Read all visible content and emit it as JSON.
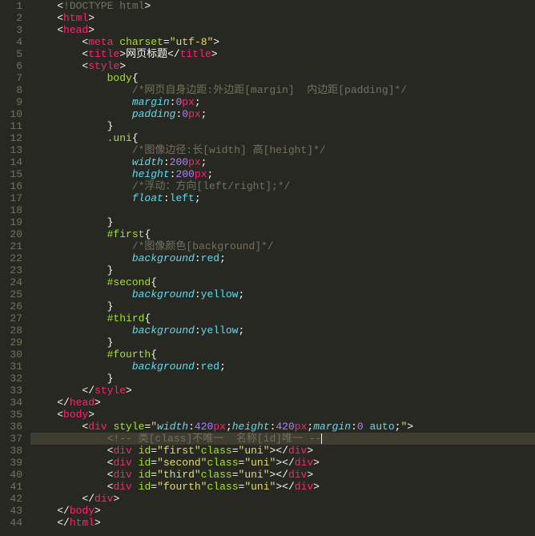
{
  "editor": {
    "lineCount": 44,
    "highlightedLine": 37,
    "lines": [
      {
        "n": 1,
        "indent": 1,
        "tokens": [
          {
            "t": "pun",
            "v": "<"
          },
          {
            "t": "doctype",
            "v": "!DOCTYPE html"
          },
          {
            "t": "pun",
            "v": ">"
          }
        ]
      },
      {
        "n": 2,
        "indent": 1,
        "tokens": [
          {
            "t": "pun",
            "v": "<"
          },
          {
            "t": "tag",
            "v": "html"
          },
          {
            "t": "pun",
            "v": ">"
          }
        ]
      },
      {
        "n": 3,
        "indent": 1,
        "tokens": [
          {
            "t": "pun",
            "v": "<"
          },
          {
            "t": "tag",
            "v": "head"
          },
          {
            "t": "pun",
            "v": ">"
          }
        ]
      },
      {
        "n": 4,
        "indent": 2,
        "tokens": [
          {
            "t": "pun",
            "v": "<"
          },
          {
            "t": "tag",
            "v": "meta"
          },
          {
            "t": "pun",
            "v": " "
          },
          {
            "t": "attr",
            "v": "charset"
          },
          {
            "t": "pun",
            "v": "="
          },
          {
            "t": "str",
            "v": "\"utf-8\""
          },
          {
            "t": "pun",
            "v": ">"
          }
        ]
      },
      {
        "n": 5,
        "indent": 2,
        "tokens": [
          {
            "t": "pun",
            "v": "<"
          },
          {
            "t": "tag",
            "v": "title"
          },
          {
            "t": "pun",
            "v": ">"
          },
          {
            "t": "pun",
            "v": "网页标题"
          },
          {
            "t": "pun",
            "v": "</"
          },
          {
            "t": "tag",
            "v": "title"
          },
          {
            "t": "pun",
            "v": ">"
          }
        ]
      },
      {
        "n": 6,
        "indent": 2,
        "tokens": [
          {
            "t": "pun",
            "v": "<"
          },
          {
            "t": "tag",
            "v": "style"
          },
          {
            "t": "pun",
            "v": ">"
          }
        ]
      },
      {
        "n": 7,
        "indent": 3,
        "tokens": [
          {
            "t": "sel",
            "v": "body"
          },
          {
            "t": "pun",
            "v": "{"
          }
        ]
      },
      {
        "n": 8,
        "indent": 4,
        "tokens": [
          {
            "t": "com",
            "v": "/*网页自身边距:外边距[margin]  内边距[padding]*/"
          }
        ]
      },
      {
        "n": 9,
        "indent": 4,
        "tokens": [
          {
            "t": "prop",
            "v": "margin"
          },
          {
            "t": "pun",
            "v": ":"
          },
          {
            "t": "num",
            "v": "0"
          },
          {
            "t": "unit",
            "v": "px"
          },
          {
            "t": "pun",
            "v": ";"
          }
        ]
      },
      {
        "n": 10,
        "indent": 4,
        "tokens": [
          {
            "t": "prop",
            "v": "padding"
          },
          {
            "t": "pun",
            "v": ":"
          },
          {
            "t": "num",
            "v": "0"
          },
          {
            "t": "unit",
            "v": "px"
          },
          {
            "t": "pun",
            "v": ";"
          }
        ]
      },
      {
        "n": 11,
        "indent": 3,
        "tokens": [
          {
            "t": "pun",
            "v": "}"
          }
        ]
      },
      {
        "n": 12,
        "indent": 3,
        "tokens": [
          {
            "t": "sel",
            "v": ".uni"
          },
          {
            "t": "pun",
            "v": "{"
          }
        ]
      },
      {
        "n": 13,
        "indent": 4,
        "tokens": [
          {
            "t": "com",
            "v": "/*图像边径:长[width] 高[height]*/"
          }
        ]
      },
      {
        "n": 14,
        "indent": 4,
        "tokens": [
          {
            "t": "prop",
            "v": "width"
          },
          {
            "t": "pun",
            "v": ":"
          },
          {
            "t": "num",
            "v": "200"
          },
          {
            "t": "unit",
            "v": "px"
          },
          {
            "t": "pun",
            "v": ";"
          }
        ]
      },
      {
        "n": 15,
        "indent": 4,
        "tokens": [
          {
            "t": "prop",
            "v": "height"
          },
          {
            "t": "pun",
            "v": ":"
          },
          {
            "t": "num",
            "v": "200"
          },
          {
            "t": "unit",
            "v": "px"
          },
          {
            "t": "pun",
            "v": ";"
          }
        ]
      },
      {
        "n": 16,
        "indent": 4,
        "tokens": [
          {
            "t": "com",
            "v": "/*浮动：方向[left/right];*/"
          }
        ]
      },
      {
        "n": 17,
        "indent": 4,
        "tokens": [
          {
            "t": "prop",
            "v": "float"
          },
          {
            "t": "pun",
            "v": ":"
          },
          {
            "t": "val",
            "v": "left"
          },
          {
            "t": "pun",
            "v": ";"
          }
        ]
      },
      {
        "n": 18,
        "indent": 0,
        "tokens": []
      },
      {
        "n": 19,
        "indent": 3,
        "tokens": [
          {
            "t": "pun",
            "v": "}"
          }
        ]
      },
      {
        "n": 20,
        "indent": 3,
        "tokens": [
          {
            "t": "sel",
            "v": "#first"
          },
          {
            "t": "pun",
            "v": "{"
          }
        ]
      },
      {
        "n": 21,
        "indent": 4,
        "tokens": [
          {
            "t": "com",
            "v": "/*图像颜色[background]*/"
          }
        ]
      },
      {
        "n": 22,
        "indent": 4,
        "tokens": [
          {
            "t": "prop",
            "v": "background"
          },
          {
            "t": "pun",
            "v": ":"
          },
          {
            "t": "val",
            "v": "red"
          },
          {
            "t": "pun",
            "v": ";"
          }
        ]
      },
      {
        "n": 23,
        "indent": 3,
        "tokens": [
          {
            "t": "pun",
            "v": "}"
          }
        ]
      },
      {
        "n": 24,
        "indent": 3,
        "tokens": [
          {
            "t": "sel",
            "v": "#second"
          },
          {
            "t": "pun",
            "v": "{"
          }
        ]
      },
      {
        "n": 25,
        "indent": 4,
        "tokens": [
          {
            "t": "prop",
            "v": "background"
          },
          {
            "t": "pun",
            "v": ":"
          },
          {
            "t": "val",
            "v": "yellow"
          },
          {
            "t": "pun",
            "v": ";"
          }
        ]
      },
      {
        "n": 26,
        "indent": 3,
        "tokens": [
          {
            "t": "pun",
            "v": "}"
          }
        ]
      },
      {
        "n": 27,
        "indent": 3,
        "tokens": [
          {
            "t": "sel",
            "v": "#third"
          },
          {
            "t": "pun",
            "v": "{"
          }
        ]
      },
      {
        "n": 28,
        "indent": 4,
        "tokens": [
          {
            "t": "prop",
            "v": "background"
          },
          {
            "t": "pun",
            "v": ":"
          },
          {
            "t": "val",
            "v": "yellow"
          },
          {
            "t": "pun",
            "v": ";"
          }
        ]
      },
      {
        "n": 29,
        "indent": 3,
        "tokens": [
          {
            "t": "pun",
            "v": "}"
          }
        ]
      },
      {
        "n": 30,
        "indent": 3,
        "tokens": [
          {
            "t": "sel",
            "v": "#fourth"
          },
          {
            "t": "pun",
            "v": "{"
          }
        ]
      },
      {
        "n": 31,
        "indent": 4,
        "tokens": [
          {
            "t": "prop",
            "v": "background"
          },
          {
            "t": "pun",
            "v": ":"
          },
          {
            "t": "val",
            "v": "red"
          },
          {
            "t": "pun",
            "v": ";"
          }
        ]
      },
      {
        "n": 32,
        "indent": 3,
        "tokens": [
          {
            "t": "pun",
            "v": "}"
          }
        ]
      },
      {
        "n": 33,
        "indent": 2,
        "tokens": [
          {
            "t": "pun",
            "v": "</"
          },
          {
            "t": "tag",
            "v": "style"
          },
          {
            "t": "pun",
            "v": ">"
          }
        ]
      },
      {
        "n": 34,
        "indent": 1,
        "tokens": [
          {
            "t": "pun",
            "v": "</"
          },
          {
            "t": "tag",
            "v": "head"
          },
          {
            "t": "pun",
            "v": ">"
          }
        ]
      },
      {
        "n": 35,
        "indent": 1,
        "tokens": [
          {
            "t": "pun",
            "v": "<"
          },
          {
            "t": "tag",
            "v": "body"
          },
          {
            "t": "pun",
            "v": ">"
          }
        ]
      },
      {
        "n": 36,
        "indent": 2,
        "tokens": [
          {
            "t": "pun",
            "v": "<"
          },
          {
            "t": "tag",
            "v": "div"
          },
          {
            "t": "pun",
            "v": " "
          },
          {
            "t": "attr",
            "v": "style"
          },
          {
            "t": "pun",
            "v": "="
          },
          {
            "t": "str",
            "v": "\""
          },
          {
            "t": "prop",
            "v": "width"
          },
          {
            "t": "pun",
            "v": ":"
          },
          {
            "t": "num",
            "v": "420"
          },
          {
            "t": "unit",
            "v": "px"
          },
          {
            "t": "pun",
            "v": ";"
          },
          {
            "t": "prop",
            "v": "height"
          },
          {
            "t": "pun",
            "v": ":"
          },
          {
            "t": "num",
            "v": "420"
          },
          {
            "t": "unit",
            "v": "px"
          },
          {
            "t": "pun",
            "v": ";"
          },
          {
            "t": "prop",
            "v": "margin"
          },
          {
            "t": "pun",
            "v": ":"
          },
          {
            "t": "num",
            "v": "0"
          },
          {
            "t": "pun",
            "v": " "
          },
          {
            "t": "val",
            "v": "auto"
          },
          {
            "t": "pun",
            "v": ";"
          },
          {
            "t": "str",
            "v": "\""
          },
          {
            "t": "pun",
            "v": ">"
          }
        ]
      },
      {
        "n": 37,
        "indent": 3,
        "tokens": [
          {
            "t": "com",
            "v": "<!-- 类[class]不唯一  名称[id]唯一 --"
          },
          {
            "t": "cursor",
            "v": ""
          },
          {
            "t": "ghost",
            "v": ">"
          }
        ]
      },
      {
        "n": 38,
        "indent": 3,
        "tokens": [
          {
            "t": "pun",
            "v": "<"
          },
          {
            "t": "tag",
            "v": "div"
          },
          {
            "t": "pun",
            "v": " "
          },
          {
            "t": "attr",
            "v": "id"
          },
          {
            "t": "pun",
            "v": "="
          },
          {
            "t": "str",
            "v": "\"first\""
          },
          {
            "t": "attr",
            "v": "class"
          },
          {
            "t": "pun",
            "v": "="
          },
          {
            "t": "str",
            "v": "\"uni\""
          },
          {
            "t": "pun",
            "v": "></"
          },
          {
            "t": "tag",
            "v": "div"
          },
          {
            "t": "pun",
            "v": ">"
          }
        ]
      },
      {
        "n": 39,
        "indent": 3,
        "tokens": [
          {
            "t": "pun",
            "v": "<"
          },
          {
            "t": "tag",
            "v": "div"
          },
          {
            "t": "pun",
            "v": " "
          },
          {
            "t": "attr",
            "v": "id"
          },
          {
            "t": "pun",
            "v": "="
          },
          {
            "t": "str",
            "v": "\"second\""
          },
          {
            "t": "attr",
            "v": "class"
          },
          {
            "t": "pun",
            "v": "="
          },
          {
            "t": "str",
            "v": "\"uni\""
          },
          {
            "t": "pun",
            "v": "></"
          },
          {
            "t": "tag",
            "v": "div"
          },
          {
            "t": "pun",
            "v": ">"
          }
        ]
      },
      {
        "n": 40,
        "indent": 3,
        "tokens": [
          {
            "t": "pun",
            "v": "<"
          },
          {
            "t": "tag",
            "v": "div"
          },
          {
            "t": "pun",
            "v": " "
          },
          {
            "t": "attr",
            "v": "id"
          },
          {
            "t": "pun",
            "v": "="
          },
          {
            "t": "str",
            "v": "\"third\""
          },
          {
            "t": "attr",
            "v": "class"
          },
          {
            "t": "pun",
            "v": "="
          },
          {
            "t": "str",
            "v": "\"uni\""
          },
          {
            "t": "pun",
            "v": "></"
          },
          {
            "t": "tag",
            "v": "div"
          },
          {
            "t": "pun",
            "v": ">"
          }
        ]
      },
      {
        "n": 41,
        "indent": 3,
        "tokens": [
          {
            "t": "pun",
            "v": "<"
          },
          {
            "t": "tag",
            "v": "div"
          },
          {
            "t": "pun",
            "v": " "
          },
          {
            "t": "attr",
            "v": "id"
          },
          {
            "t": "pun",
            "v": "="
          },
          {
            "t": "str",
            "v": "\"fourth\""
          },
          {
            "t": "attr",
            "v": "class"
          },
          {
            "t": "pun",
            "v": "="
          },
          {
            "t": "str",
            "v": "\"uni\""
          },
          {
            "t": "pun",
            "v": "></"
          },
          {
            "t": "tag",
            "v": "div"
          },
          {
            "t": "pun",
            "v": ">"
          }
        ]
      },
      {
        "n": 42,
        "indent": 2,
        "tokens": [
          {
            "t": "pun",
            "v": "</"
          },
          {
            "t": "tag",
            "v": "div"
          },
          {
            "t": "pun",
            "v": ">"
          }
        ]
      },
      {
        "n": 43,
        "indent": 1,
        "tokens": [
          {
            "t": "pun",
            "v": "</"
          },
          {
            "t": "tag",
            "v": "body"
          },
          {
            "t": "pun",
            "v": ">"
          }
        ]
      },
      {
        "n": 44,
        "indent": 1,
        "tokens": [
          {
            "t": "pun",
            "v": "</"
          },
          {
            "t": "tag",
            "v": "html"
          },
          {
            "t": "pun",
            "v": ">"
          }
        ]
      }
    ]
  }
}
